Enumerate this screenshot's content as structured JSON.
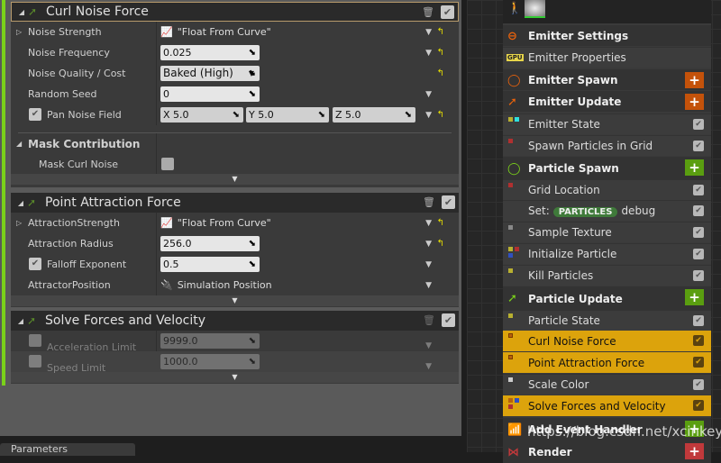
{
  "curl_noise": {
    "title": "Curl Noise Force",
    "rows": {
      "noise_strength": {
        "label": "Noise Strength",
        "value": "\"Float From Curve\""
      },
      "noise_frequency": {
        "label": "Noise Frequency",
        "value": "0.025"
      },
      "noise_quality": {
        "label": "Noise Quality / Cost",
        "value": "Baked (High)"
      },
      "random_seed": {
        "label": "Random Seed",
        "value": "0"
      },
      "pan_noise_field": {
        "label": "Pan Noise Field",
        "checked": true,
        "x": "X  5.0",
        "y": "Y  5.0",
        "z": "Z  5.0"
      }
    },
    "mask": {
      "title": "Mask Contribution",
      "mask_curl_noise": {
        "label": "Mask Curl Noise",
        "checked": false
      }
    }
  },
  "point_attraction": {
    "title": "Point Attraction Force",
    "rows": {
      "strength": {
        "label": "AttractionStrength",
        "value": "\"Float From Curve\""
      },
      "radius": {
        "label": "Attraction Radius",
        "value": "256.0"
      },
      "falloff": {
        "label": "Falloff Exponent",
        "checked": true,
        "value": "0.5"
      },
      "position": {
        "label": "AttractorPosition",
        "value": "Simulation Position"
      }
    }
  },
  "solve_forces": {
    "title": "Solve Forces and Velocity",
    "rows": {
      "accel": {
        "label": "Acceleration Limit",
        "checked": false,
        "value": "9999.0"
      },
      "speed": {
        "label": "Speed Limit",
        "checked": false,
        "value": "1000.0"
      }
    }
  },
  "bottom_tab": "Parameters",
  "stack": {
    "items": [
      {
        "label": "Emitter Settings"
      },
      {
        "label": "Emitter Properties",
        "icon_text": "GPU"
      },
      {
        "label": "Emitter Spawn"
      },
      {
        "label": "Emitter Update"
      },
      {
        "label": "Emitter State"
      },
      {
        "label": "Spawn Particles in Grid"
      },
      {
        "label": "Particle Spawn"
      },
      {
        "label": "Grid Location"
      },
      {
        "label": "Set:",
        "pill": "PARTICLES",
        "suffix": "debug"
      },
      {
        "label": "Sample Texture"
      },
      {
        "label": "Initialize Particle"
      },
      {
        "label": "Kill Particles"
      },
      {
        "label": "Particle Update"
      },
      {
        "label": "Particle State"
      },
      {
        "label": "Curl Noise Force"
      },
      {
        "label": "Point Attraction Force"
      },
      {
        "label": "Scale Color"
      },
      {
        "label": "Solve Forces and Velocity"
      },
      {
        "label": "Add Event Handler"
      },
      {
        "label": "Render"
      }
    ]
  },
  "colors": {
    "emitter": "#e8620c",
    "particle": "#7ad11a",
    "highlight": "#dca30c",
    "render": "#c0393b"
  },
  "watermark": "https://blog.csdn.net/xcinkey"
}
